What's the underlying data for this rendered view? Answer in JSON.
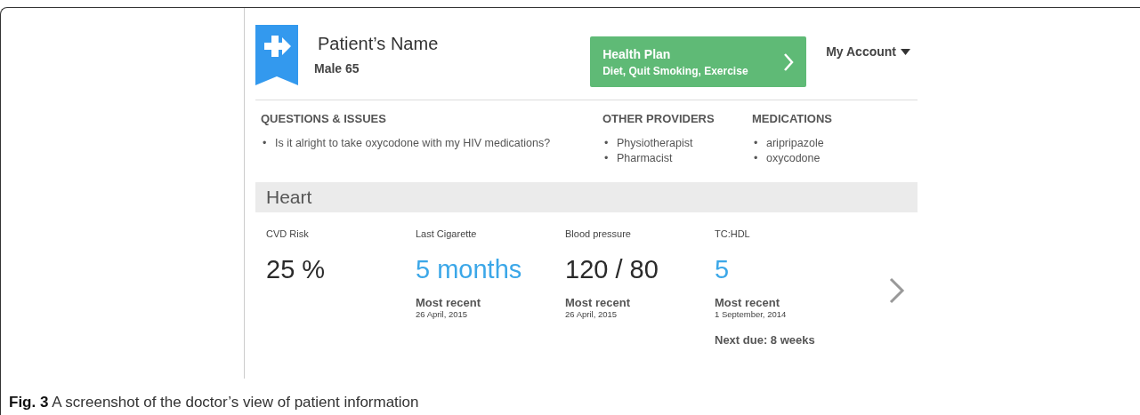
{
  "patient": {
    "name": "Patient’s Name",
    "details": "Male 65"
  },
  "health_plan": {
    "title": "Health Plan",
    "subtitle": "Diet, Quit Smoking, Exercise"
  },
  "account_menu": {
    "label": "My Account"
  },
  "panels": [
    {
      "heading": "QUESTIONS & ISSUES",
      "items": [
        {
          "marker": "•",
          "text": "Is it alright to take oxycodone with my HIV medications?"
        }
      ]
    },
    {
      "heading": "OTHER PROVIDERS",
      "items": [
        {
          "marker": "•",
          "text": "Physiotherapist"
        },
        {
          "marker": "•",
          "text": "Pharmacist"
        }
      ]
    },
    {
      "heading": "MEDICATIONS",
      "items": [
        {
          "marker": "•",
          "text": "aripripazole"
        },
        {
          "marker": "•",
          "text": "oxycodone"
        }
      ]
    }
  ],
  "section": {
    "title": "Heart"
  },
  "metrics": [
    {
      "label": "CVD Risk",
      "value": "25 %",
      "highlight": false
    },
    {
      "label": "Last Cigarette",
      "value": "5 months",
      "highlight": true,
      "recent_label": "Most recent",
      "recent_date": "26 April, 2015"
    },
    {
      "label": "Blood pressure",
      "value": "120 / 80",
      "highlight": false,
      "recent_label": "Most recent",
      "recent_date": "26 April, 2015"
    },
    {
      "label": "TC:HDL",
      "value": "5",
      "highlight": true,
      "recent_label": "Most recent",
      "recent_date": "1 September, 2014",
      "next_due": "Next due: 8 weeks"
    }
  ],
  "caption": {
    "label": "Fig. 3",
    "text": "A screenshot of the doctor’s view of patient information"
  }
}
